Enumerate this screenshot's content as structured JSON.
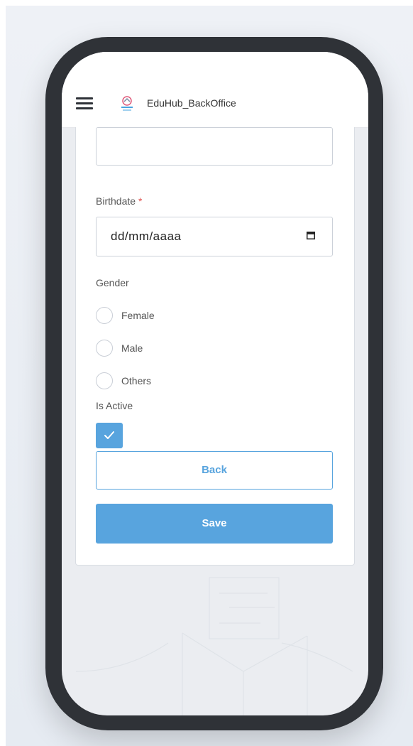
{
  "header": {
    "app_title": "EduHub_BackOffice",
    "menu_icon": "hamburger-menu-icon",
    "logo_icon": "eduhub-logo-icon"
  },
  "form": {
    "birthdate": {
      "label": "Birthdate",
      "required_marker": "*",
      "value": "dd/mm/aaaa",
      "icon": "calendar-icon"
    },
    "gender": {
      "label": "Gender",
      "options": [
        "Female",
        "Male",
        "Others"
      ],
      "selected": null
    },
    "is_active": {
      "label": "Is Active",
      "checked": true,
      "icon": "checkmark-icon"
    },
    "buttons": {
      "back_label": "Back",
      "save_label": "Save"
    }
  },
  "colors": {
    "accent": "#58a4de",
    "required": "#e0524f",
    "phone_frame": "#2f3237",
    "screen_bg": "#ebedf1"
  }
}
